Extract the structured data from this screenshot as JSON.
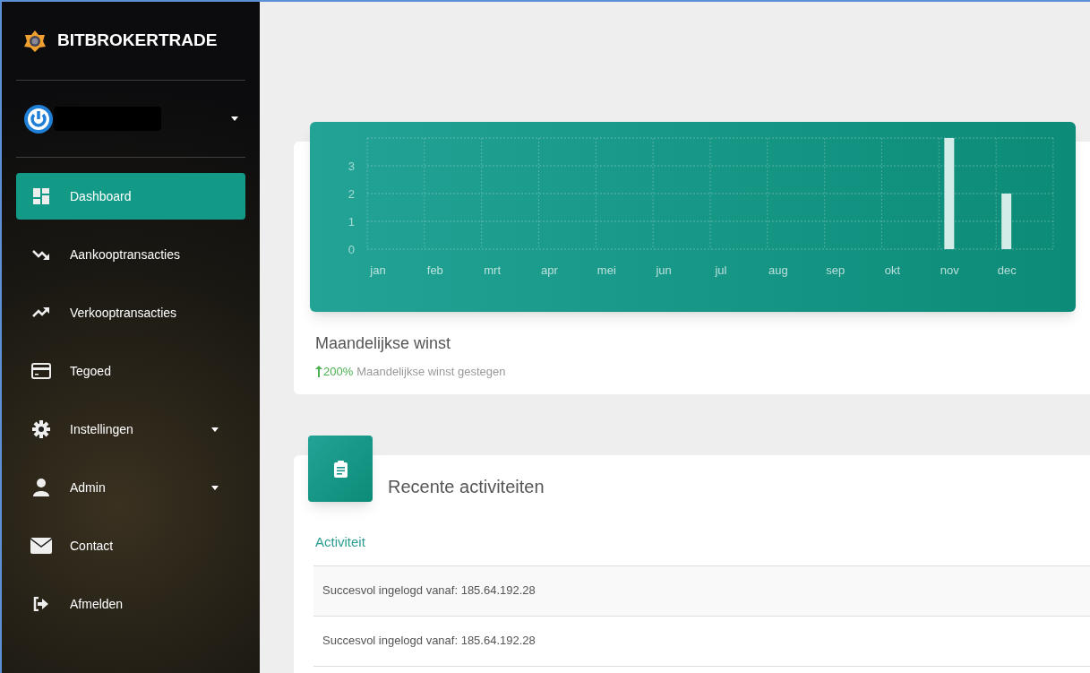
{
  "sidebar": {
    "brand": "BITBROKERTRADE",
    "user": {
      "has_dropdown": true
    },
    "items": [
      {
        "label": "Dashboard",
        "selected": true,
        "has_dropdown": false
      },
      {
        "label": "Aankooptransacties",
        "selected": false,
        "has_dropdown": false
      },
      {
        "label": "Verkooptransacties",
        "selected": false,
        "has_dropdown": false
      },
      {
        "label": "Tegoed",
        "selected": false,
        "has_dropdown": false
      },
      {
        "label": "Instellingen",
        "selected": false,
        "has_dropdown": true
      },
      {
        "label": "Admin",
        "selected": false,
        "has_dropdown": true
      },
      {
        "label": "Contact",
        "selected": false,
        "has_dropdown": false
      },
      {
        "label": "Afmelden",
        "selected": false,
        "has_dropdown": false
      }
    ]
  },
  "profit_card": {
    "chart_data": {
      "type": "bar",
      "categories": [
        "jan",
        "feb",
        "mrt",
        "apr",
        "mei",
        "jun",
        "jul",
        "aug",
        "sep",
        "okt",
        "nov",
        "dec"
      ],
      "series": [
        {
          "color": "#d4ece8",
          "values": [
            0,
            0,
            0,
            0,
            0,
            0,
            0,
            0,
            0,
            0,
            4,
            2
          ]
        }
      ],
      "ylim": [
        0,
        4
      ],
      "yticks": [
        0,
        1,
        2,
        3
      ],
      "grid": true
    },
    "title": "Maandelijkse winst",
    "change": "200%",
    "caption": "Maandelijkse winst gestegen"
  },
  "activity_card": {
    "title": "Recente activiteiten",
    "column": "Activiteit",
    "rows": [
      "Succesvol ingelogd vanaf: 185.64.192.28",
      "Succesvol ingelogd vanaf: 185.64.192.28"
    ]
  }
}
